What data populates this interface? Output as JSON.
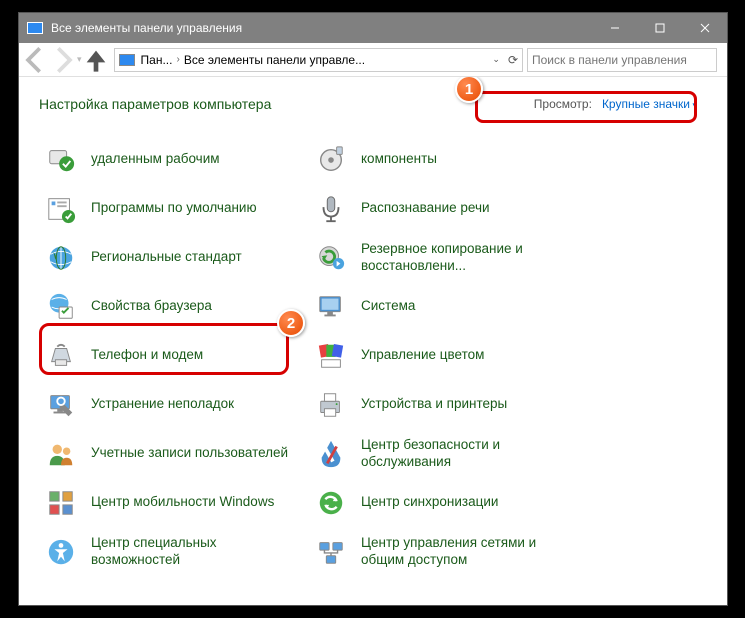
{
  "titlebar": {
    "title": "Все элементы панели управления"
  },
  "breadcrumb": {
    "p1": "Пан...",
    "p2": "Все элементы панели управле..."
  },
  "search": {
    "placeholder": "Поиск в панели управления"
  },
  "header": {
    "title": "Настройка параметров компьютера"
  },
  "view": {
    "label": "Просмотр:",
    "value": "Крупные значки"
  },
  "badges": {
    "b1": "1",
    "b2": "2"
  },
  "left": [
    {
      "name": "remote-desktop",
      "label": "удаленным рабочим"
    },
    {
      "name": "default-programs",
      "label": "Программы по умолчанию"
    },
    {
      "name": "regional-settings",
      "label": "Региональные стандарт"
    },
    {
      "name": "internet-options",
      "label": "Свойства браузера"
    },
    {
      "name": "phone-modem",
      "label": "Телефон и модем"
    },
    {
      "name": "troubleshoot",
      "label": "Устранение неполадок"
    },
    {
      "name": "user-accounts",
      "label": "Учетные записи пользователей"
    },
    {
      "name": "mobility-center",
      "label": "Центр мобильности Windows"
    },
    {
      "name": "accessibility",
      "label": "Центр специальных возможностей"
    }
  ],
  "right": [
    {
      "name": "components",
      "label": "компоненты"
    },
    {
      "name": "speech-recognition",
      "label": "Распознавание речи"
    },
    {
      "name": "backup-restore",
      "label": "Резервное копирование и восстановлени..."
    },
    {
      "name": "system",
      "label": "Система"
    },
    {
      "name": "color-management",
      "label": "Управление цветом"
    },
    {
      "name": "devices-printers",
      "label": "Устройства и принтеры"
    },
    {
      "name": "security-maintenance",
      "label": "Центр безопасности и обслуживания"
    },
    {
      "name": "sync-center",
      "label": "Центр синхронизации"
    },
    {
      "name": "network-sharing",
      "label": "Центр управления сетями и общим доступом"
    }
  ]
}
